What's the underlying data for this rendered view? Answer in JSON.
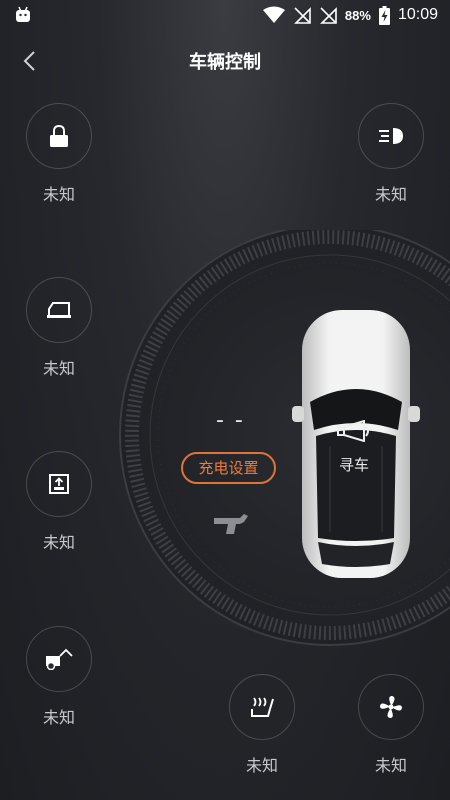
{
  "status_bar": {
    "battery_percent": "88%",
    "time": "10:09",
    "icons": [
      "android-notification-icon",
      "wifi-icon",
      "no-sim-icon",
      "no-sim-icon",
      "battery-charging-icon"
    ]
  },
  "header": {
    "title": "车辆控制",
    "back_icon": "chevron-left-icon"
  },
  "controls": {
    "door_lock": {
      "icon": "lock-icon",
      "status": "未知"
    },
    "headlights": {
      "icon": "headlight-icon",
      "status": "未知"
    },
    "window": {
      "icon": "car-window-icon",
      "status": "未知"
    },
    "sunroof": {
      "icon": "sunroof-icon",
      "status": "未知"
    },
    "trunk": {
      "icon": "trunk-open-icon",
      "status": "未知"
    },
    "seat_heating": {
      "icon": "seat-heating-icon",
      "status": "未知"
    },
    "fan": {
      "icon": "fan-icon",
      "status": "未知"
    }
  },
  "center": {
    "charge_value": "- -",
    "charge_settings_label": "充电设置",
    "plug_icon": "charging-plug-icon",
    "find_car_label": "寻车",
    "find_car_icon": "horn-icon"
  },
  "colors": {
    "accent": "#f07a3c",
    "background": "#23252a",
    "label": "#c7c8ca"
  }
}
